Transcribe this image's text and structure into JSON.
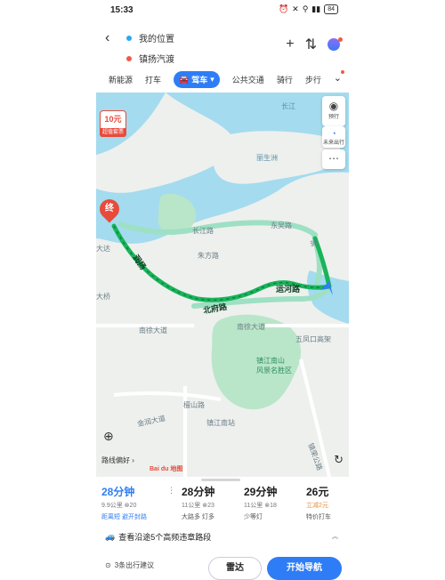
{
  "status": {
    "time": "15:33",
    "battery": "84"
  },
  "route": {
    "origin": "我的位置",
    "destination": "镇扬汽渡"
  },
  "modes": {
    "items": [
      "新能源",
      "打车",
      "驾车",
      "公共交通",
      "骑行",
      "步行"
    ],
    "active": "驾车"
  },
  "map": {
    "toll_amount": "10元",
    "toll_tag": "超值套票",
    "end_marker": "终",
    "ctrl_layers": "预行",
    "ctrl_future": "未来出行",
    "labels": {
      "changjiang": "长江",
      "lishengzhou": "丽生洲",
      "changjianglu": "长江路",
      "dongwulu": "东吴路",
      "zhujiang": "禁",
      "rundong": "润扬",
      "zhufang": "朱方路",
      "dada": "大达",
      "daqiao": "大桥",
      "beifulu": "北府路",
      "yunhelu": "运河路",
      "nanxudadao": "南徐大道",
      "nanxudadao2": "南徐大道",
      "wufengkou": "五凤口高架",
      "nanshan": "镇江南山\n风景名胜区",
      "jinrun": "金润大道",
      "tiyu": "檀山路",
      "zhenjiangnan": "镇江南站",
      "jinhua": "镇荣公路"
    },
    "preference": "路线偏好",
    "logo": "Bai du 地图"
  },
  "options": [
    {
      "time": "28分钟",
      "dist": "9.9公里",
      "lights": "20",
      "tags": "距离短 避开封路",
      "selected": true
    },
    {
      "time": "28分钟",
      "dist": "11公里",
      "lights": "23",
      "tags": "大路多 灯多",
      "selected": false
    },
    {
      "time": "29分钟",
      "dist": "11公里",
      "lights": "18",
      "tags": "少等灯",
      "selected": false
    },
    {
      "time": "26元",
      "sub": "立减2元",
      "tags": "特价打车",
      "taxi": true
    }
  ],
  "violation": "查看沿途5个高频违章路段",
  "bottom": {
    "suggestion": "3条出行建议",
    "radar": "雷达",
    "navigate": "开始导航"
  },
  "colors": {
    "accent": "#2f7df6",
    "route": "#19b45a",
    "water": "#9fd6ec",
    "green": "#b9e6c9"
  }
}
